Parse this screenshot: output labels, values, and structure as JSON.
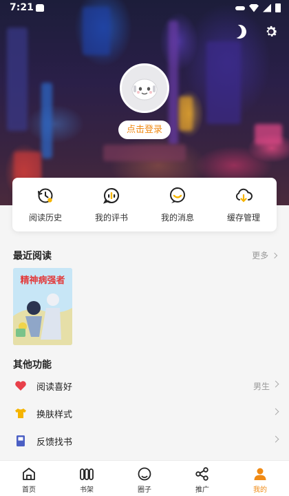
{
  "status_bar": {
    "time": "7:21"
  },
  "profile": {
    "login_label": "点击登录"
  },
  "quick_actions": [
    {
      "label": "阅读历史",
      "icon": "history-icon"
    },
    {
      "label": "我的评书",
      "icon": "review-icon"
    },
    {
      "label": "我的消息",
      "icon": "message-icon"
    },
    {
      "label": "缓存管理",
      "icon": "cloud-download-icon"
    }
  ],
  "recent": {
    "title": "最近阅读",
    "more_label": "更多",
    "book_cover_text": "精神病强者"
  },
  "other": {
    "title": "其他功能",
    "items": [
      {
        "label": "阅读喜好",
        "value": "男生",
        "icon": "heart-icon"
      },
      {
        "label": "换肤样式",
        "value": "",
        "icon": "shirt-icon"
      },
      {
        "label": "反馈找书",
        "value": "",
        "icon": "book-icon"
      }
    ]
  },
  "bottom_nav": [
    {
      "label": "首页",
      "icon": "home-icon"
    },
    {
      "label": "书架",
      "icon": "bookshelf-icon"
    },
    {
      "label": "圈子",
      "icon": "circle-icon"
    },
    {
      "label": "推广",
      "icon": "share-icon"
    },
    {
      "label": "我的",
      "icon": "profile-icon"
    }
  ],
  "colors": {
    "accent": "#f08a14",
    "heart": "#e8404a",
    "shirt": "#f5b400",
    "book": "#4b5fc4"
  }
}
